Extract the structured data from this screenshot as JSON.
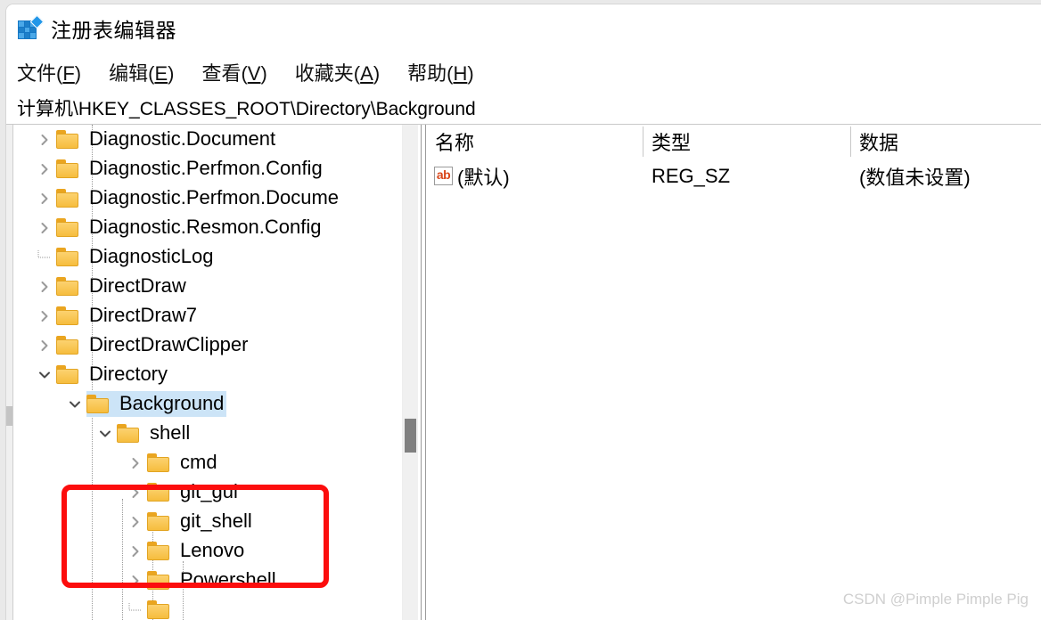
{
  "window": {
    "title": "注册表编辑器",
    "app_icon": "registry-editor-icon"
  },
  "menubar": {
    "items": [
      {
        "label": "文件(F)",
        "text": "文件(",
        "key": "F",
        "tail": ")"
      },
      {
        "label": "编辑(E)",
        "text": "编辑(",
        "key": "E",
        "tail": ")"
      },
      {
        "label": "查看(V)",
        "text": "查看(",
        "key": "V",
        "tail": ")"
      },
      {
        "label": "收藏夹(A)",
        "text": "收藏夹(",
        "key": "A",
        "tail": ")"
      },
      {
        "label": "帮助(H)",
        "text": "帮助(",
        "key": "H",
        "tail": ")"
      }
    ]
  },
  "address_bar": {
    "path": "计算机\\HKEY_CLASSES_ROOT\\Directory\\Background"
  },
  "tree": {
    "rows": [
      {
        "label": "Diagnostic.Document",
        "indent": 0,
        "twisty": "collapsed",
        "selected": false
      },
      {
        "label": "Diagnostic.Perfmon.Config",
        "indent": 0,
        "twisty": "collapsed",
        "selected": false
      },
      {
        "label": "Diagnostic.Perfmon.Docume",
        "indent": 0,
        "twisty": "collapsed",
        "selected": false
      },
      {
        "label": "Diagnostic.Resmon.Config",
        "indent": 0,
        "twisty": "collapsed",
        "selected": false
      },
      {
        "label": "DiagnosticLog",
        "indent": 0,
        "twisty": "none",
        "selected": false
      },
      {
        "label": "DirectDraw",
        "indent": 0,
        "twisty": "collapsed",
        "selected": false
      },
      {
        "label": "DirectDraw7",
        "indent": 0,
        "twisty": "collapsed",
        "selected": false
      },
      {
        "label": "DirectDrawClipper",
        "indent": 0,
        "twisty": "collapsed",
        "selected": false
      },
      {
        "label": "Directory",
        "indent": 0,
        "twisty": "expanded",
        "selected": false
      },
      {
        "label": "Background",
        "indent": 1,
        "twisty": "expanded",
        "selected": true
      },
      {
        "label": "shell",
        "indent": 2,
        "twisty": "expanded",
        "selected": false
      },
      {
        "label": "cmd",
        "indent": 3,
        "twisty": "collapsed",
        "selected": false
      },
      {
        "label": "git_gui",
        "indent": 3,
        "twisty": "collapsed",
        "selected": false
      },
      {
        "label": "git_shell",
        "indent": 3,
        "twisty": "collapsed",
        "selected": false
      },
      {
        "label": "Lenovo",
        "indent": 3,
        "twisty": "collapsed",
        "selected": false
      },
      {
        "label": "Powershell",
        "indent": 3,
        "twisty": "collapsed",
        "selected": false
      },
      {
        "label": "",
        "indent": 3,
        "twisty": "none",
        "selected": false
      }
    ]
  },
  "list": {
    "columns": [
      "名称",
      "类型",
      "数据"
    ],
    "rows": [
      {
        "name": "(默认)",
        "type": "REG_SZ",
        "data": "(数值未设置)",
        "icon": "ab-string-icon"
      }
    ]
  },
  "annotation": {
    "highlight_color": "#fc0d0d"
  },
  "watermark": {
    "text": "CSDN @Pimple Pimple Pig"
  }
}
